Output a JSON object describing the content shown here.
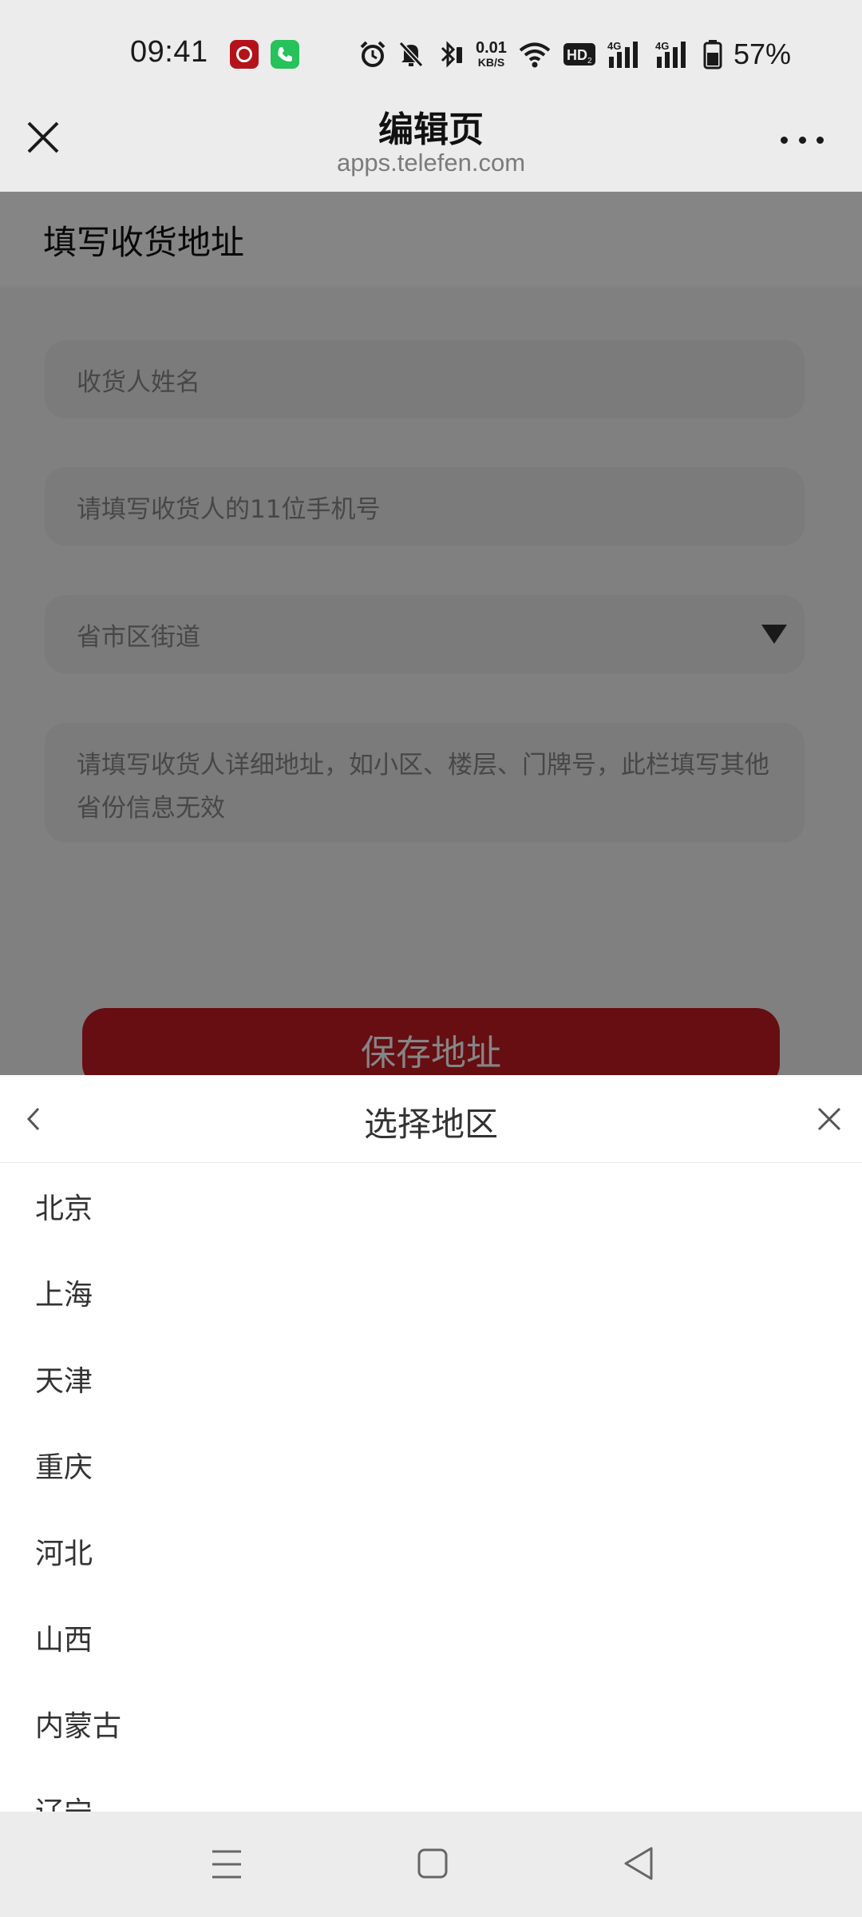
{
  "status_bar": {
    "time": "09:41",
    "net_speed": "0.01",
    "net_speed_unit": "KB/S",
    "network_1": "4G",
    "network_2": "4G",
    "battery_percent": "57%",
    "icons": [
      "icbc-app-icon",
      "phone-app-icon",
      "alarm-icon",
      "mute-icon",
      "bluetooth-icon",
      "wifi-icon",
      "hd-icon",
      "signal-icon",
      "signal-icon",
      "battery-icon"
    ]
  },
  "header": {
    "title": "编辑页",
    "url": "apps.telefen.com",
    "close_icon": "close-icon",
    "more_icon": "more-dots-icon"
  },
  "form": {
    "section_title": "填写收货地址",
    "name_placeholder": "收货人姓名",
    "phone_placeholder": "请填写收货人的11位手机号",
    "region_placeholder": "省市区街道",
    "address_placeholder": "请填写收货人详细地址，如小区、楼层、门牌号，此栏填写其他省份信息无效",
    "save_label": "保存地址",
    "colors": {
      "save_button": "#c41c24",
      "field_bg": "#ececec"
    }
  },
  "region_picker": {
    "title": "选择地区",
    "regions": [
      "北京",
      "上海",
      "天津",
      "重庆",
      "河北",
      "山西",
      "内蒙古",
      "辽宁"
    ]
  },
  "nav_bar": {
    "icons": [
      "menu-icon",
      "home-icon",
      "back-triangle-icon"
    ]
  }
}
